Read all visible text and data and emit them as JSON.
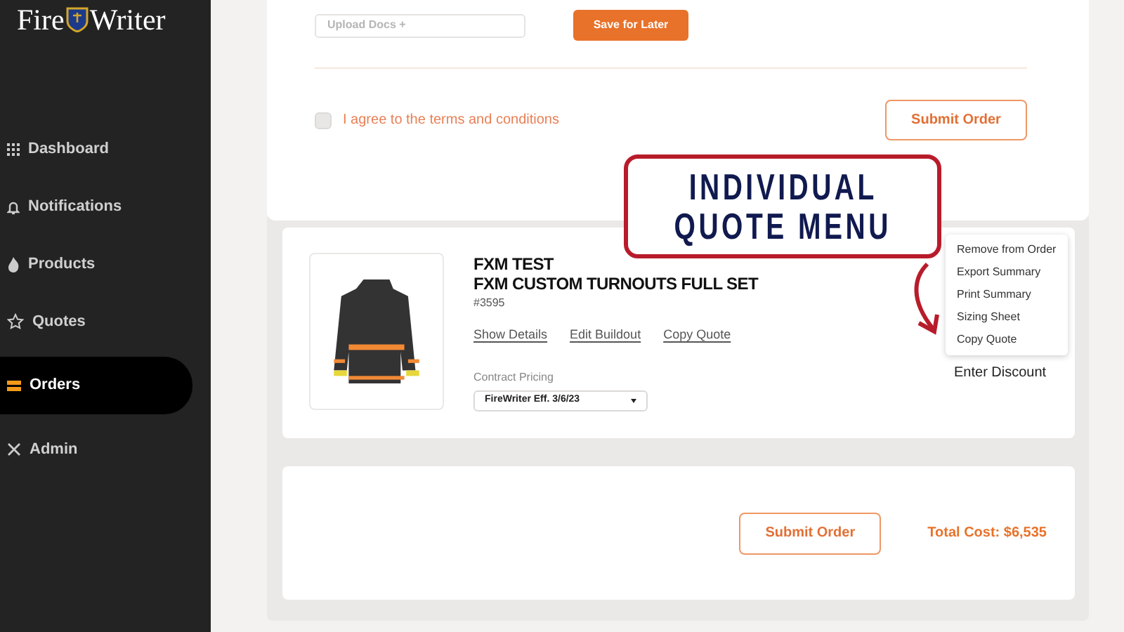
{
  "brand": {
    "name_left": "Fire",
    "name_right": "Writer"
  },
  "sidebar": {
    "items": [
      {
        "label": "Dashboard",
        "selected": false
      },
      {
        "label": "Notifications",
        "selected": false
      },
      {
        "label": "Products",
        "selected": false
      },
      {
        "label": "Quotes",
        "selected": false
      },
      {
        "label": "Orders",
        "selected": true
      },
      {
        "label": "Admin",
        "selected": false
      }
    ]
  },
  "order_form": {
    "upload": {
      "placeholder": "Upload Docs +"
    },
    "save_button": "Save for Later",
    "terms": {
      "label": "I agree to the terms and conditions",
      "checked": false
    },
    "submit_button": "Submit Order"
  },
  "quote": {
    "title": "FXM TEST",
    "subtitle": "FXM CUSTOM TURNOUTS FULL SET",
    "number": "#3595",
    "links": [
      "Show Details",
      "Edit Buildout",
      "Copy Quote"
    ],
    "pricing_label": "Contract Pricing",
    "pricing_value": "FireWriter Eff. 3/6/23",
    "discount_label": "Enter Discount",
    "menu": [
      "Remove from Order",
      "Export Summary",
      "Print Summary",
      "Sizing Sheet",
      "Copy Quote"
    ]
  },
  "summary": {
    "submit_button": "Submit Order",
    "total": "Total Cost: $6,535"
  },
  "annotation": {
    "lines": [
      "INDIVIDUAL",
      "QUOTE MENU"
    ]
  }
}
